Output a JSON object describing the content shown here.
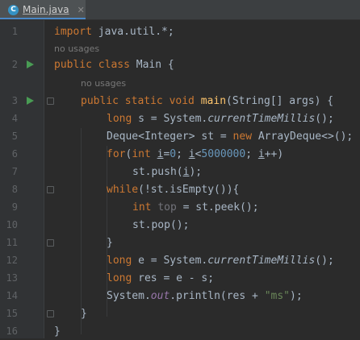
{
  "tab": {
    "file_name": "Main.java",
    "close_glyph": "✕",
    "icon_letter": "C"
  },
  "hints": {
    "no_usages": "no usages"
  },
  "lines": [
    {
      "n": "1",
      "text": "import java.util.*;"
    },
    {
      "n": "2",
      "text": "public class Main {"
    },
    {
      "n": "3",
      "text": "public static void main(String[] args) {"
    },
    {
      "n": "4",
      "text": "long s = System.currentTimeMillis();"
    },
    {
      "n": "5",
      "text": "Deque<Integer> st = new ArrayDeque<>();"
    },
    {
      "n": "6",
      "text": "for(int i=0; i<5000000; i++)"
    },
    {
      "n": "7",
      "text": "st.push(i);"
    },
    {
      "n": "8",
      "text": "while(!st.isEmpty()){"
    },
    {
      "n": "9",
      "text": "int top = st.peek();"
    },
    {
      "n": "10",
      "text": "st.pop();"
    },
    {
      "n": "11",
      "text": "}"
    },
    {
      "n": "12",
      "text": "long e = System.currentTimeMillis();"
    },
    {
      "n": "13",
      "text": "long res = e - s;"
    },
    {
      "n": "14",
      "text": "System.out.println(res + \"ms\");"
    },
    {
      "n": "15",
      "text": "}"
    },
    {
      "n": "16",
      "text": "}"
    }
  ],
  "colors": {
    "background": "#2b2b2b",
    "keyword": "#cc7832",
    "number": "#6897bb",
    "string": "#6a8759",
    "method_decl": "#ffc66d",
    "static_field": "#9876aa",
    "run_icon": "#499c54"
  },
  "icons": {
    "run": "play-triangle-icon",
    "fold": "fold-marker-icon",
    "file": "java-class-icon"
  }
}
